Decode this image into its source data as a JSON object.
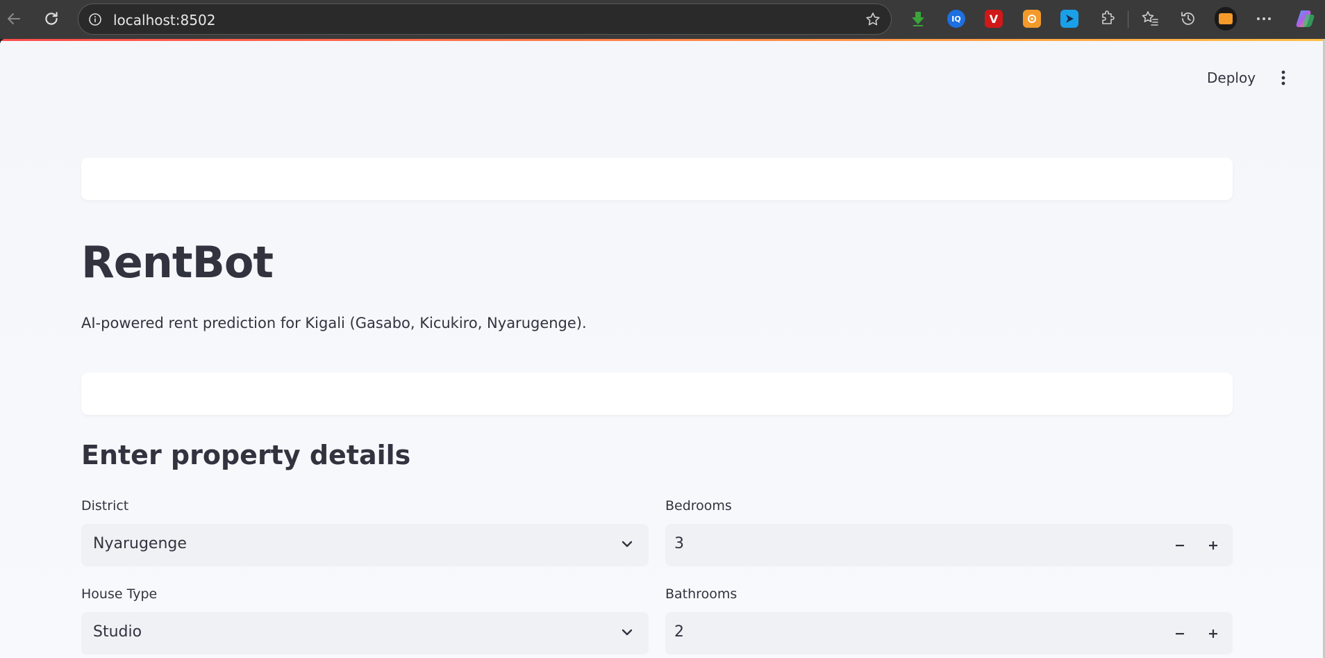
{
  "browser": {
    "url": "localhost:8502",
    "extensions": [
      {
        "name": "download-extension-icon",
        "color": "#3aa53a"
      },
      {
        "name": "iq-extension-icon",
        "color": "#1e6fe0",
        "text": "IQ"
      },
      {
        "name": "vivaldi-extension-icon",
        "color": "#d01818",
        "text": "V"
      },
      {
        "name": "orange-extension-icon",
        "color": "#f39a2b"
      },
      {
        "name": "blue-arrow-extension-icon",
        "color": "#1aa0e8"
      }
    ]
  },
  "header": {
    "deploy_label": "Deploy"
  },
  "app": {
    "title": "RentBot",
    "subtitle": "AI-powered rent prediction for Kigali (Gasabo, Kicukiro, Nyarugenge).",
    "section_title": "Enter property details"
  },
  "form": {
    "district": {
      "label": "District",
      "value": "Nyarugenge"
    },
    "house_type": {
      "label": "House Type",
      "value": "Studio"
    },
    "bedrooms": {
      "label": "Bedrooms",
      "value": "3"
    },
    "bathrooms": {
      "label": "Bathrooms",
      "value": "2"
    }
  },
  "colors": {
    "accent_start": "#ff4b4b",
    "accent_end": "#ffbd45",
    "text": "#31333f"
  }
}
